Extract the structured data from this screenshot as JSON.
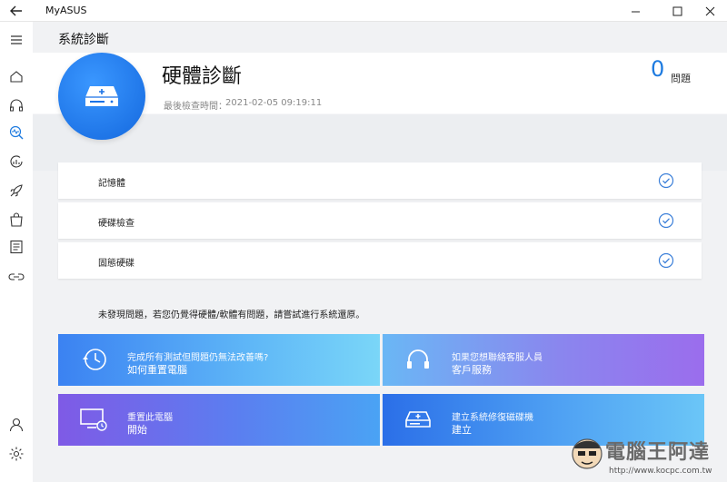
{
  "app": {
    "title": "MyASUS"
  },
  "page": {
    "title": "系統診斷"
  },
  "hero": {
    "title": "硬體診斷",
    "last_check_label": "最後檢查時間：",
    "last_check_time": "2021-02-05 09:19:11",
    "issue_count": "0",
    "issue_label": "問題"
  },
  "checks": [
    {
      "label": "記憶體",
      "status": "ok"
    },
    {
      "label": "硬碟檢查",
      "status": "ok"
    },
    {
      "label": "固態硬碟",
      "status": "ok"
    }
  ],
  "note": "未發現問題，若您仍覺得硬體/軟體有問題，請嘗試進行系統還原。",
  "cards": [
    {
      "sub": "完成所有測試但問題仍無法改善嗎?",
      "label": "如何重置電腦",
      "icon": "clock-restore-icon"
    },
    {
      "sub": "如果您想聯絡客服人員",
      "label": "客戶服務",
      "icon": "headset-icon"
    },
    {
      "sub": "重置此電腦",
      "label": "開始",
      "icon": "monitor-reset-icon"
    },
    {
      "sub": "建立系統修復磁碟機",
      "label": "建立",
      "icon": "drive-plus-icon"
    }
  ],
  "watermark": {
    "text": "電腦王阿達",
    "url": "http://www.kocpc.com.tw"
  },
  "colors": {
    "accent": "#1e7be0",
    "hero_circle": "#1f7cf0"
  }
}
